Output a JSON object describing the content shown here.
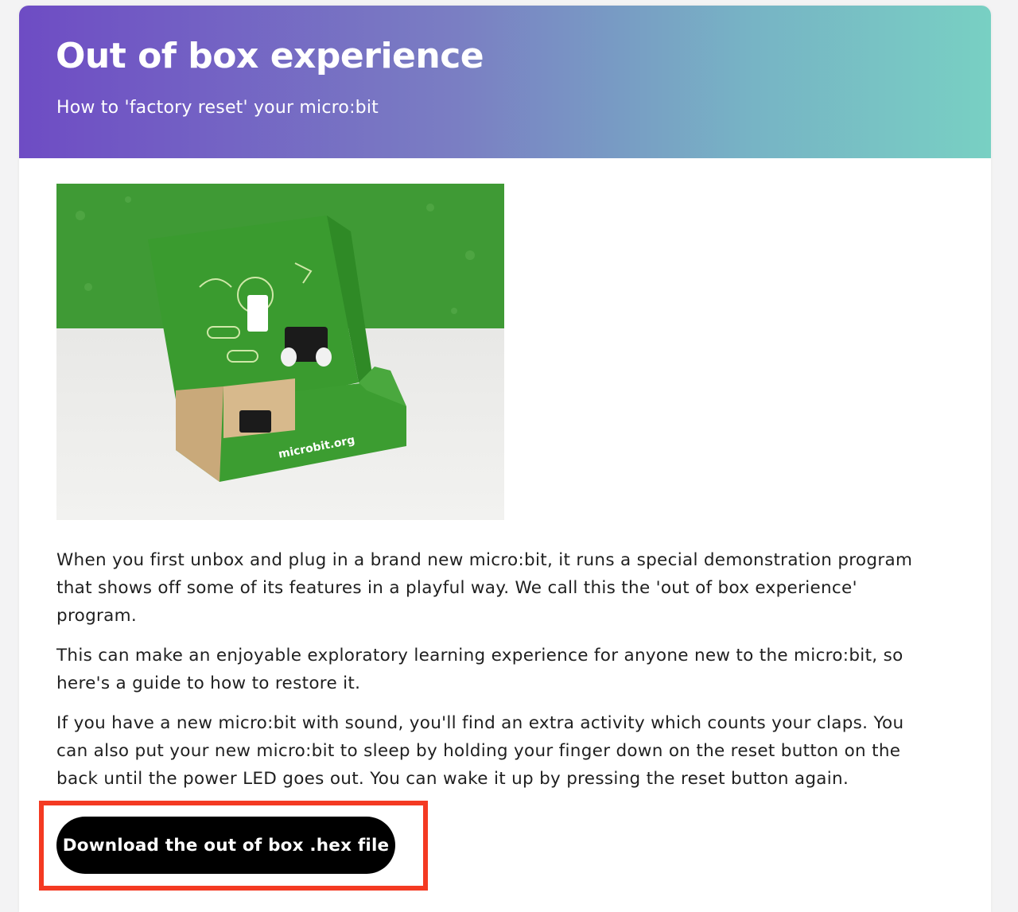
{
  "hero": {
    "title": "Out of box experience",
    "subtitle": "How to 'factory reset' your micro:bit",
    "gradient_start": "#6e4cc4",
    "gradient_end": "#78d0c3"
  },
  "image": {
    "caption_text": "microbit.org",
    "box_color": "#3f9a35"
  },
  "paragraphs": [
    "When you first unbox and plug in a brand new micro:bit, it runs a special demonstration program that shows off some of its features in a playful way. We call this the 'out of box experience' program.",
    "This can make an enjoyable exploratory learning experience for anyone new to the micro:bit, so here's a guide to how to restore it.",
    "If you have a new micro:bit with sound, you'll find an extra activity which counts your claps. You can also put your new micro:bit to sleep by holding your finger down on the reset button on the back until the power LED goes out. You can wake it up by pressing the reset button again."
  ],
  "download_button": {
    "label": "Download the out of box .hex file",
    "highlight_color": "#f43a22"
  }
}
